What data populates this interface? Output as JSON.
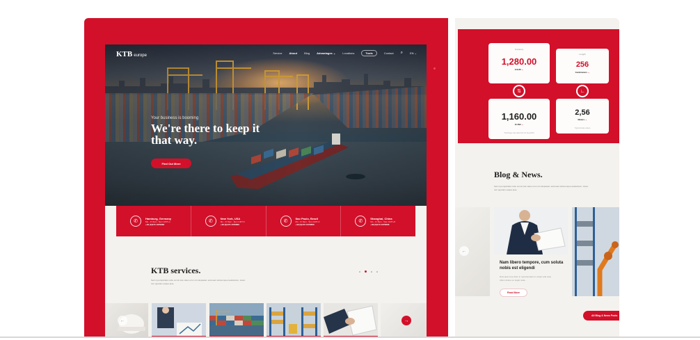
{
  "site": {
    "logo": "KTB",
    "logo_sub": "europe",
    "nav": [
      "Service",
      "About",
      "Blog",
      "Advantages",
      "Locations",
      "Tools",
      "Contact"
    ],
    "nav_lang": "EN",
    "eyebrow": "Your business is booming",
    "headline": "We're there to keep it that way.",
    "cta": "Find Out More",
    "locations": [
      {
        "city": "Hamburg, Germany",
        "hours": "Mo - Fr 8am - 5pm GMT+1",
        "phone": "+49 (0)173 1679666"
      },
      {
        "city": "New York, USA",
        "hours": "Mo - Fr 8am - 5pm GMT-5",
        "phone": "+49 (0)173 1679666"
      },
      {
        "city": "Sao Paulo, Brazil",
        "hours": "Mo - Fr 8am - 5pm GMT-3",
        "phone": "+49 (0)173 1679666"
      },
      {
        "city": "Shanghai, China",
        "hours": "Mo - Fr 8am - 5pm GMT+8",
        "phone": "+49 (0)173 1679666"
      }
    ],
    "services_title": "KTB services.",
    "services_text": "Sed ut perspiciatis unde omnis iste natus error sit voluptatem accusant doloremque laudantium, totam rem aperiam eaque ipsa."
  },
  "converter": {
    "currency": {
      "label": "Currency",
      "from_value": "1,280.00",
      "from_unit": "€ EUR",
      "to_value": "1,160.00",
      "to_unit": "$ USD",
      "note": "*Exchange rate data from 01.Aug.2024"
    },
    "length": {
      "label": "Length",
      "from_value": "256",
      "from_unit": "Centimeters",
      "to_value": "2,56",
      "to_unit": "Meters",
      "note": "*Approximate values"
    }
  },
  "blog": {
    "title": "Blog & News.",
    "text": "Sed ut perspiciatis unde omnis iste natus error sit voluptatem accusant doloremque laudantium, totam rem aperiam eaque ipsa.",
    "post_title": "Nam libero tempore, cum soluta nobis est eligendi",
    "post_text": "Duis aute irure dolor in reprehenderit in volupt velit esse cillum dolore eu fugiat nulla...",
    "read_more": "Read More",
    "all_button": "All Blog & News Posts"
  },
  "icons": {
    "nav_search": "search-icon",
    "nav_chevron": "chevron-down-icon",
    "location": "phone-icon",
    "prev": "arrow-left-icon",
    "next": "arrow-right-icon",
    "currency_swap": "currency-swap-icon",
    "length_swap": "ruler-icon"
  },
  "colors": {
    "brand_red": "#d2102a",
    "background": "#f4f2ee",
    "dark_text": "#1d1d1d"
  }
}
